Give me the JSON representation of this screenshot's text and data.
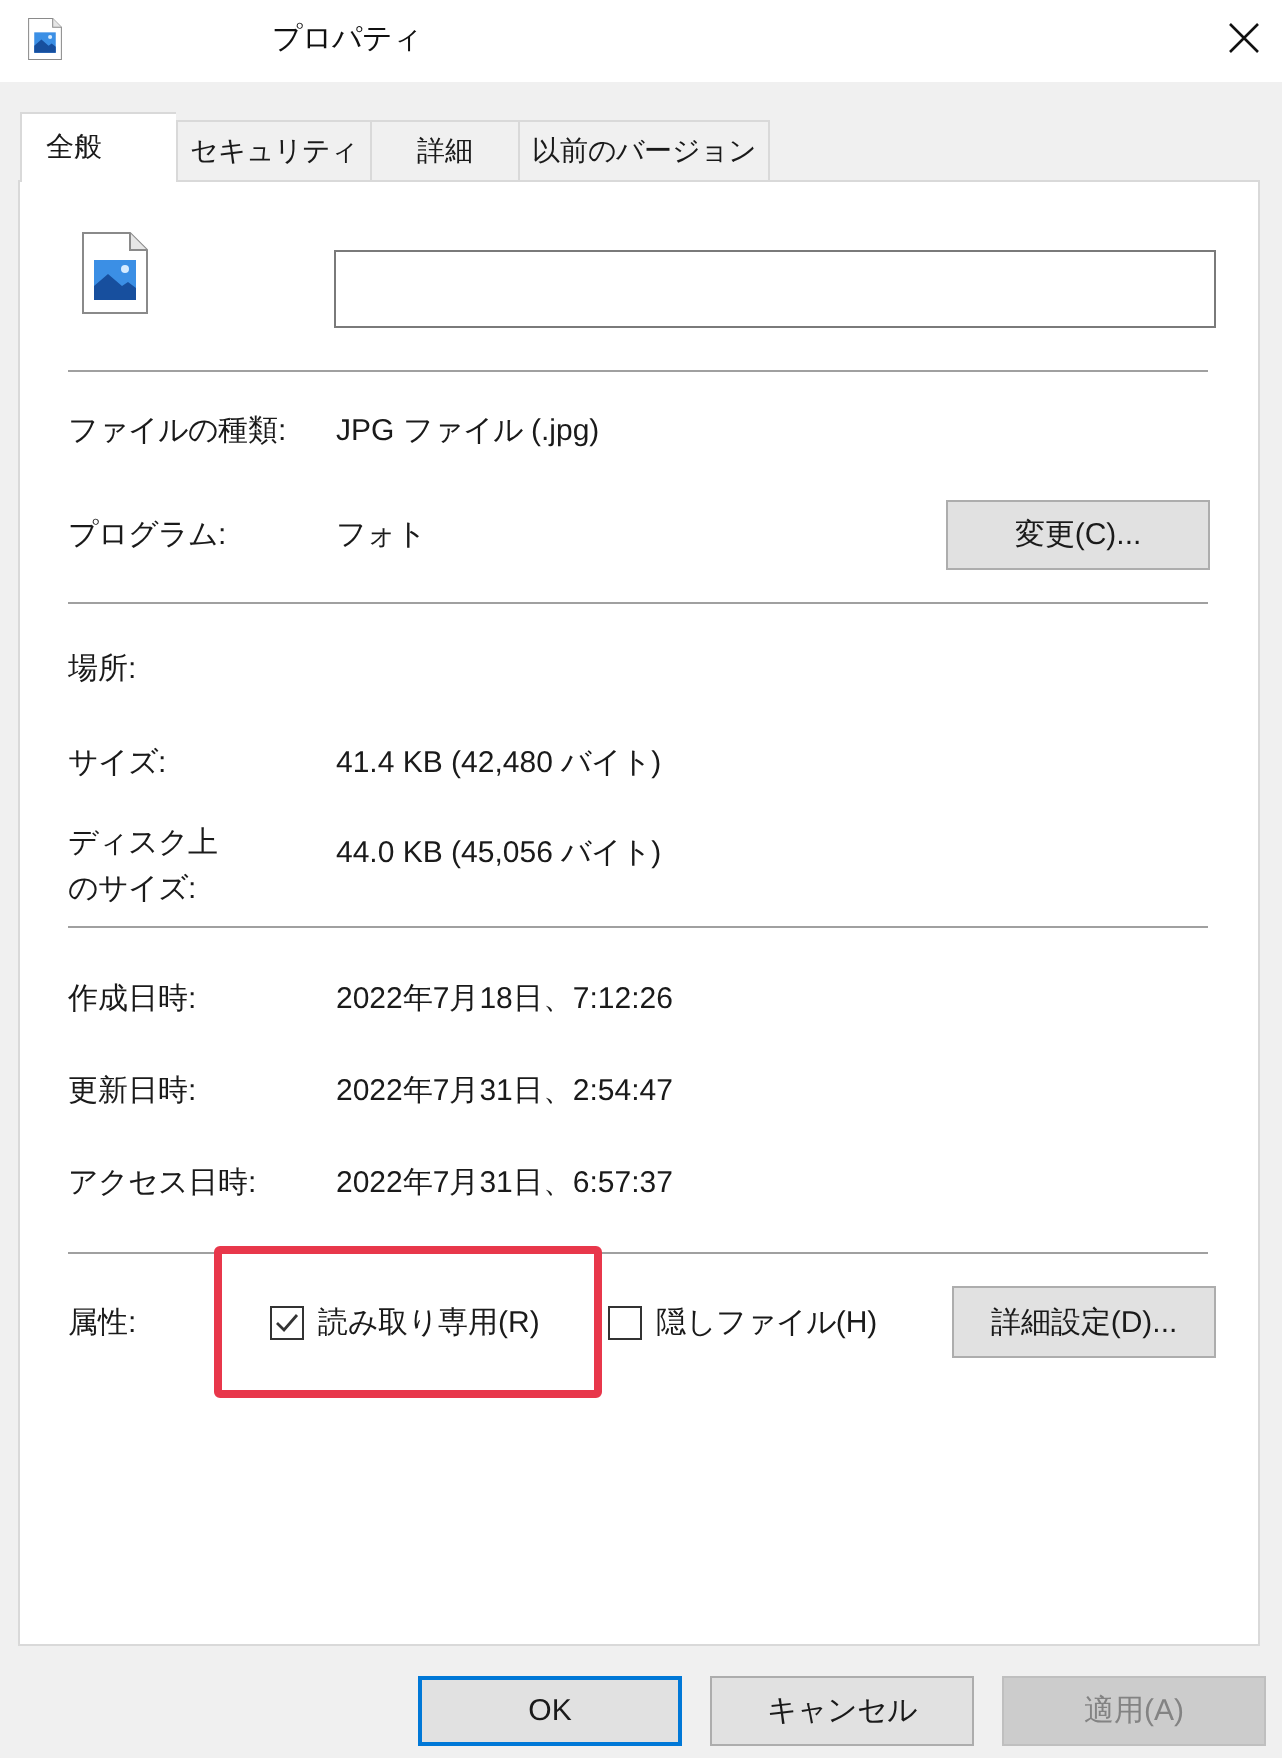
{
  "window": {
    "title": "プロパティ"
  },
  "tabs": [
    {
      "label": "全般",
      "selected": true
    },
    {
      "label": "セキュリティ",
      "selected": false
    },
    {
      "label": "詳細",
      "selected": false
    },
    {
      "label": "以前のバージョン",
      "selected": false
    }
  ],
  "sections": [
    {
      "rows": [
        {
          "label": "ファイルの種類:",
          "value": "JPG ファイル (.jpg)"
        },
        {
          "label": "プログラム:",
          "value": "フォト",
          "button": "変更(C)..."
        }
      ]
    },
    {
      "rows": [
        {
          "label": "場所:"
        },
        {
          "label": "サイズ:",
          "value": "41.4 KB (42,480 バイト)"
        },
        {
          "label": "ディスク上のサイズ:",
          "value": "44.0 KB (45,056 バイト)"
        }
      ]
    },
    {
      "rows": [
        {
          "label": "作成日時:",
          "value": "2022年7月18日、7:12:26"
        },
        {
          "label": "更新日時:",
          "value": "2022年7月31日、2:54:47"
        },
        {
          "label": "アクセス日時:",
          "value": "2022年7月31日、6:57:37"
        }
      ]
    }
  ],
  "attributes": {
    "label": "属性:",
    "options": [
      {
        "label": "読み取り専用(R)",
        "checked": true,
        "highlighted": true
      },
      {
        "label": "隠しファイル(H)",
        "checked": false,
        "highlighted": false
      }
    ],
    "button": "詳細設定(D)..."
  },
  "buttons": [
    {
      "label": "OK",
      "default": true,
      "disabled": false
    },
    {
      "label": "キャンセル",
      "default": false,
      "disabled": false
    },
    {
      "label": "適用(A)",
      "default": false,
      "disabled": true
    }
  ]
}
